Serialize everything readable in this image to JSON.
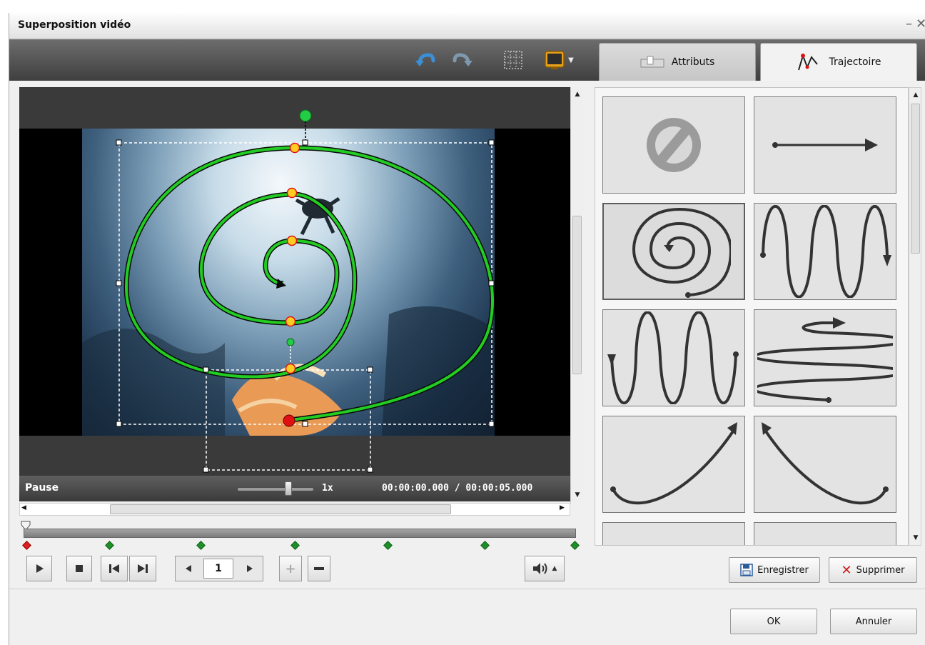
{
  "window": {
    "title": "Superposition vidéo"
  },
  "tabs": {
    "attributs": "Attributs",
    "trajectoire": "Trajectoire"
  },
  "status": {
    "state": "Pause",
    "speed": "1x",
    "time": "00:00:00.000 / 00:00:05.000"
  },
  "playback": {
    "frame": "1"
  },
  "panel": {
    "save_label": "Enregistrer",
    "delete_label": "Supprimer"
  },
  "footer": {
    "ok_label": "OK",
    "cancel_label": "Annuler"
  },
  "presets": [
    {
      "name": "no-trajectory-icon"
    },
    {
      "name": "straight-arrow-icon"
    },
    {
      "name": "spiral-icon",
      "selected": true
    },
    {
      "name": "sine-wave-down-icon"
    },
    {
      "name": "sine-wave-up-icon"
    },
    {
      "name": "horizontal-zigzag-icon"
    },
    {
      "name": "curve-up-right-icon"
    },
    {
      "name": "curve-up-left-icon"
    },
    {
      "name": "arrow-left-icon"
    },
    {
      "name": "arrow-right-curve-icon"
    }
  ],
  "colors": {
    "trajectory": "#22cc22",
    "keypoint": "#ffcc22",
    "start_point": "#e01010",
    "keyframe": "#1f8f2a"
  }
}
